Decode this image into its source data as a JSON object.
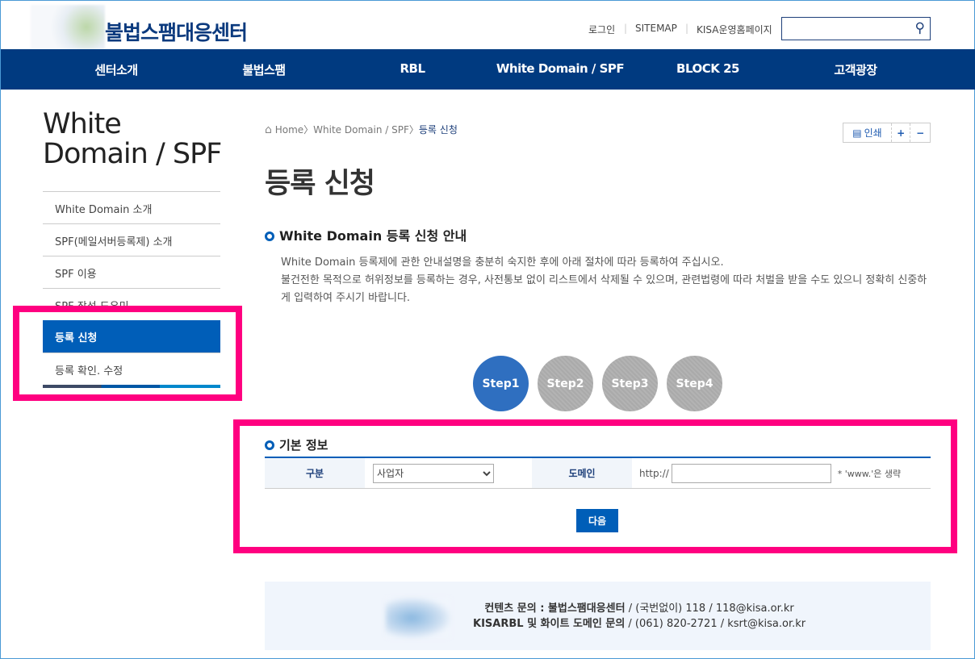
{
  "header": {
    "site_title": "불법스팸대응센터",
    "login": "로그인",
    "sitemap": "SITEMAP",
    "kisa": "KISA운영홈페이지",
    "search_placeholder": ""
  },
  "nav": [
    "센터소개",
    "불법스팸",
    "RBL",
    "White Domain / SPF",
    "BLOCK 25",
    "고객광장"
  ],
  "sidebar": {
    "title_line1": "White",
    "title_line2": "Domain / SPF",
    "items": [
      {
        "label": "White Domain 소개"
      },
      {
        "label": "SPF(메일서버등록제) 소개"
      },
      {
        "label": "SPF 이용"
      },
      {
        "label": "SPF 작성 도우미"
      },
      {
        "label": "등록 신청",
        "active": true
      },
      {
        "label": "등록 확인. 수정"
      }
    ]
  },
  "breadcrumb": {
    "home": "Home",
    "sep1": "〉",
    "level1": "White Domain / SPF",
    "sep2": "〉",
    "current": "등록 신청"
  },
  "tools": {
    "print": "인쇄",
    "zoom_in": "+",
    "zoom_out": "−"
  },
  "page_title": "등록 신청",
  "guide": {
    "title": "White Domain 등록 신청 안내",
    "line1": "White Domain 등록제에 관한 안내설명을 충분히 숙지한 후에 아래 절차에 따라 등록하여 주십시오.",
    "line2": "불건전한 목적으로 허위정보를 등록하는 경우, 사전통보 없이 리스트에서 삭제될 수 있으며, 관련법령에 따라 처벌을 받을 수도 있으니 정확히 신중하게 입력하여 주시기 바랍니다."
  },
  "steps": [
    {
      "label": "Step1",
      "active": true
    },
    {
      "label": "Step2"
    },
    {
      "label": "Step3"
    },
    {
      "label": "Step4"
    }
  ],
  "form": {
    "title": "기본 정보",
    "type_label": "구분",
    "type_value": "사업자",
    "domain_label": "도메인",
    "domain_prefix": "http://",
    "domain_value": "",
    "note": "* 'www.'은 생략",
    "next": "다음"
  },
  "footer": {
    "l1_bold": "컨텐츠 문의 : 불법스팸대응센터",
    "l1_rest": " / (국번없이) 118 / 118@kisa.or.kr",
    "l2_bold": "KISARBL 및 화이트 도메인 문의",
    "l2_rest": " / (061) 820-2721 / ksrt@kisa.or.kr"
  },
  "colors": {
    "nav": "#003a80",
    "accent": "#005eb8",
    "highlight": "#ff0080"
  }
}
